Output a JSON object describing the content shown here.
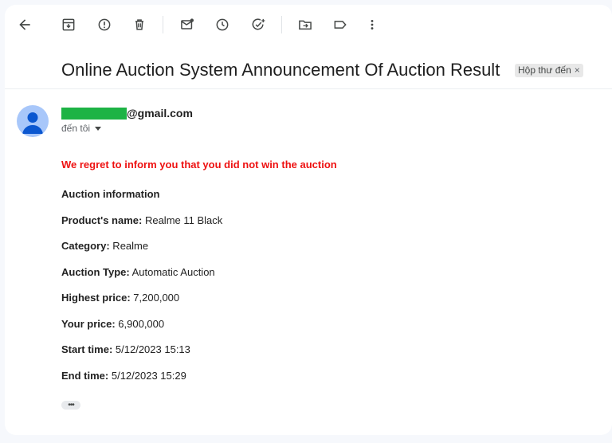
{
  "email": {
    "subject": "Online Auction System Announcement Of Auction Result",
    "label": "Hộp thư đến",
    "label_close": "×",
    "sender_email": "@gmail.com",
    "recipient": "đến tôi"
  },
  "body": {
    "regret": "We regret to inform you that you did not win the auction",
    "section_title": "Auction information",
    "product_label": "Product's name:",
    "product_value": " Realme 11 Black",
    "category_label": "Category:",
    "category_value": " Realme",
    "type_label": "Auction Type:",
    "type_value": " Automatic Auction",
    "highest_label": "Highest price:",
    "highest_value": " 7,200,000",
    "your_label": "Your price:",
    "your_value": " 6,900,000",
    "start_label": "Start time:",
    "start_value": " 5/12/2023 15:13",
    "end_label": "End time:",
    "end_value": " 5/12/2023 15:29",
    "more": "•••"
  },
  "colors": {
    "regret": "#ee1111",
    "redaction": "#1db345",
    "avatar": "#a8c7fa",
    "avatar_figure": "#0b57d0"
  },
  "icons": [
    "back-arrow-icon",
    "archive-icon",
    "report-spam-icon",
    "delete-icon",
    "mark-unread-icon",
    "snooze-icon",
    "add-task-icon",
    "move-to-icon",
    "label-icon",
    "more-vert-icon",
    "caret-down-icon",
    "person-icon"
  ]
}
